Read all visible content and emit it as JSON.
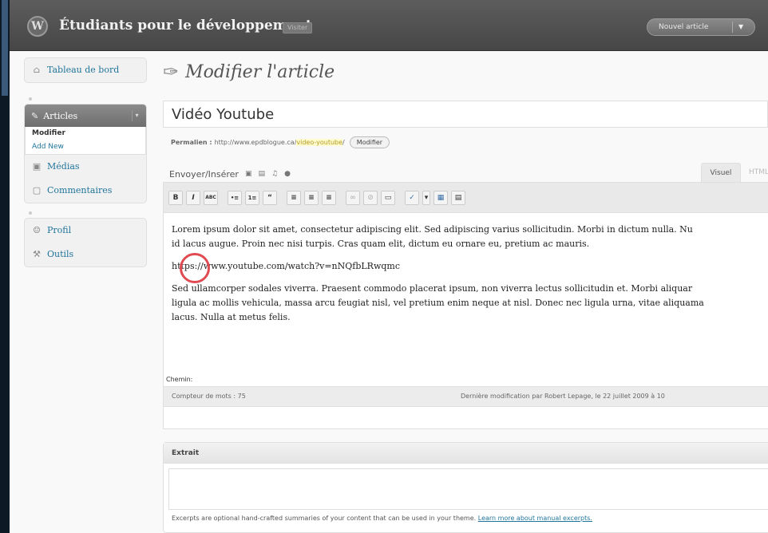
{
  "header": {
    "logo": "W",
    "site_title": "Étudiants pour le développement",
    "visit_label": "Visiter",
    "new_article_label": "Nouvel article"
  },
  "sidebar": {
    "dashboard": "Tableau de bord",
    "articles": "Articles",
    "articles_sub": {
      "edit": "Modifier",
      "add_new": "Add New"
    },
    "media": "Médias",
    "comments": "Commentaires",
    "profile": "Profil",
    "tools": "Outils"
  },
  "page": {
    "title": "Modifier l'article",
    "post_title": "Vidéo Youtube",
    "permalink_label": "Permalien :",
    "permalink_base": "http://www.epdblogue.ca/",
    "permalink_slug": "video-youtube",
    "permalink_suffix": "/",
    "permalink_edit": "Modifier"
  },
  "editor": {
    "upload_label": "Envoyer/Insérer",
    "tab_visual": "Visuel",
    "tab_html": "HTML",
    "toolbar": [
      "B",
      "I",
      "ABC",
      "•≡",
      "1≡",
      "“",
      "≡",
      "≡",
      "≡",
      "∞",
      "⊘",
      "▭",
      "✓",
      "▾",
      "▦",
      "▤"
    ],
    "paragraph1": "Lorem ipsum dolor sit amet, consectetur adipiscing elit. Sed adipiscing varius sollicitudin. Morbi in dictum nulla. Nu",
    "paragraph1b": "id lacus augue. Proin nec nisi turpis. Cras quam elit, dictum eu ornare eu, pretium ac mauris.",
    "url_line": "https://www.youtube.com/watch?v=nNQfbLRwqmc",
    "paragraph2": "Sed ullamcorper sodales viverra. Praesent commodo placerat ipsum, non viverra lectus sollicitudin et. Morbi aliquar",
    "paragraph2b": "ligula ac mollis vehicula, massa arcu feugiat nisl, vel pretium enim neque at nisl. Donec nec ligula urna, vitae aliquama",
    "paragraph2c": "lacus. Nulla at metus felis.",
    "path_label": "Chemin:",
    "word_count": "Compteur de mots : 75",
    "last_modified": "Dernière modification par Robert Lepage, le 22 juillet 2009 à 10"
  },
  "excerpt": {
    "title": "Extrait",
    "help_text": "Excerpts are optional hand-crafted summaries of your content that can be used in your theme.",
    "help_link": "Learn more about manual excerpts."
  }
}
